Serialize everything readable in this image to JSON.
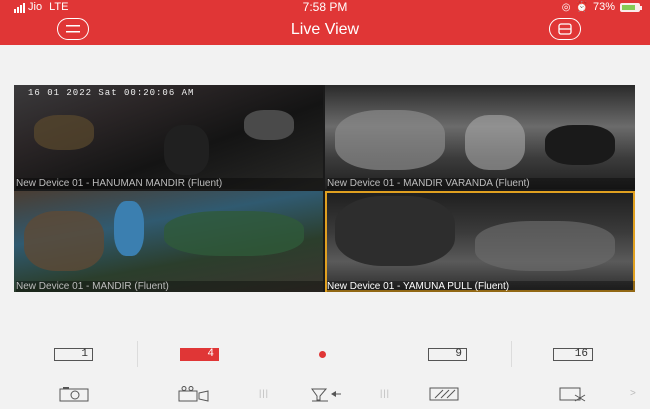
{
  "status_bar": {
    "carrier": "Jio",
    "network": "LTE",
    "time": "7:58 PM",
    "battery": "73%"
  },
  "header": {
    "title": "Live View",
    "menu_icon": "menu-icon",
    "layout_icon": "layout-icon"
  },
  "cameras": [
    {
      "timestamp": "16 01 2022 Sat 00:20:06 AM",
      "caption": "New Device 01 - HANUMAN MANDIR (Fluent)"
    },
    {
      "timestamp": "",
      "caption": "New Device 01 - MANDIR VARANDA (Fluent)"
    },
    {
      "timestamp": "",
      "caption": "New Device 01 - MANDIR (Fluent)"
    },
    {
      "timestamp": "",
      "caption": "New Device 01 - YAMUNA PULL (Fluent)",
      "selected": true
    }
  ],
  "split_tabs": {
    "one": "1",
    "four": "4",
    "nine": "9",
    "sixteen": "16",
    "active": "4"
  },
  "toolbar": {
    "icons": [
      "capture-icon",
      "record-icon",
      "ptz-icon",
      "image-quality-icon",
      "stop-all-icon"
    ],
    "more": ">"
  },
  "colors": {
    "accent": "#e03636",
    "selected_border": "#e0a020",
    "battery_fill": "#7ed957"
  }
}
